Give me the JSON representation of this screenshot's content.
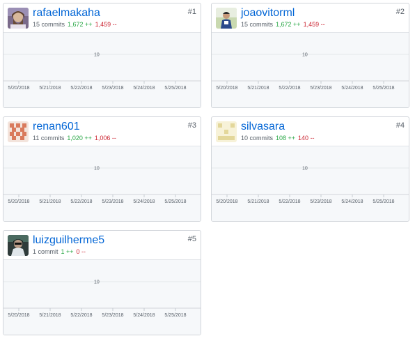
{
  "contributors": [
    {
      "rank": "#1",
      "username": "rafaelmakaha",
      "commits": "15 commits",
      "additions": "1,672 ++",
      "deletions": "1,459 --",
      "avatar_icon": "bearded-portrait-avatar"
    },
    {
      "rank": "#2",
      "username": "joaovitorml",
      "commits": "15 commits",
      "additions": "1,672 ++",
      "deletions": "1,459 --",
      "avatar_icon": "person-photo-avatar"
    },
    {
      "rank": "#3",
      "username": "renan601",
      "commits": "11 commits",
      "additions": "1,020 ++",
      "deletions": "1,006 --",
      "avatar_icon": "orange-identicon"
    },
    {
      "rank": "#4",
      "username": "silvasara",
      "commits": "10 commits",
      "additions": "108 ++",
      "deletions": "140 --",
      "avatar_icon": "yellow-identicon"
    },
    {
      "rank": "#5",
      "username": "luizguilherme5",
      "commits": "1 commit",
      "additions": "1 ++",
      "deletions": "0 --",
      "avatar_icon": "person-dark-photo-avatar"
    }
  ],
  "chart": {
    "y_tick": "10",
    "x_ticks": [
      "5/20/2018",
      "5/21/2018",
      "5/22/2018",
      "5/23/2018",
      "5/24/2018",
      "5/25/2018"
    ]
  },
  "colors": {
    "link": "#0366d6",
    "additions": "#28a745",
    "deletions": "#cb2431",
    "plot_bg": "#f6f8fa"
  }
}
